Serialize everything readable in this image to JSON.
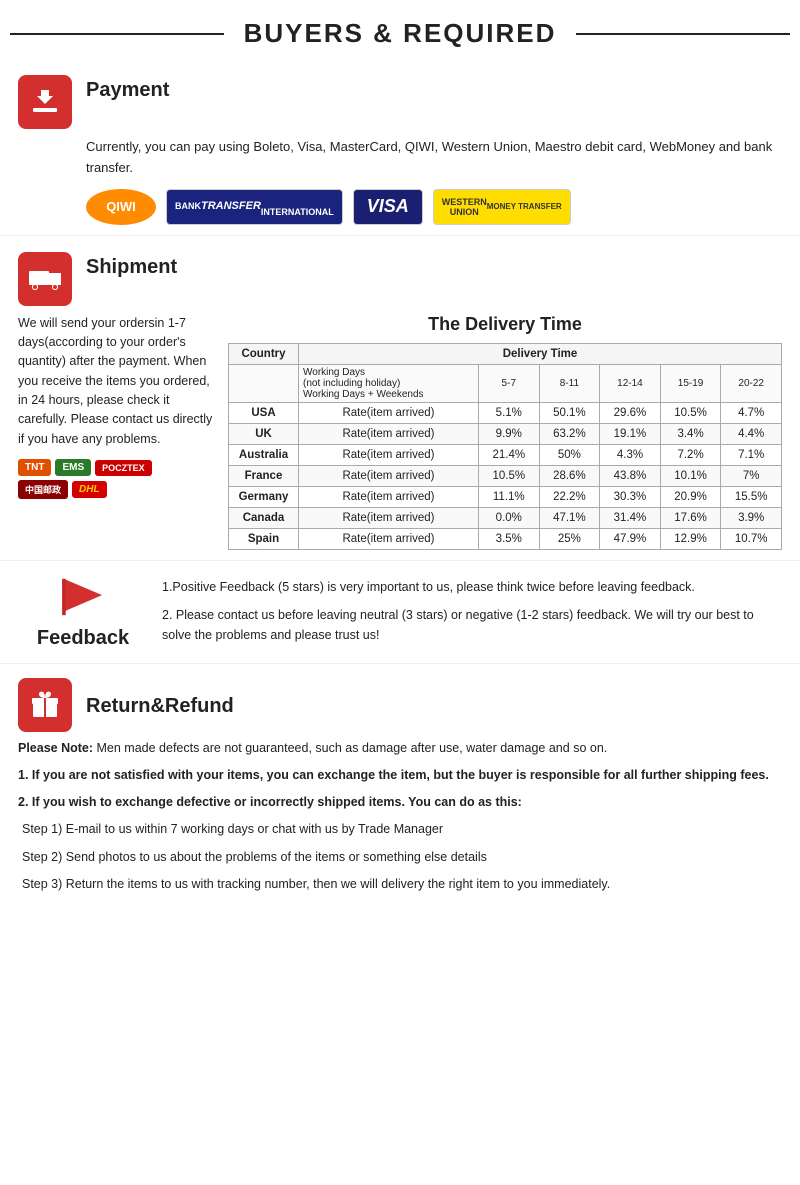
{
  "header": {
    "title": "BUYERS & REQUIRED"
  },
  "payment": {
    "section_label": "Payment",
    "description": "Currently, you can pay using Boleto, Visa, MasterCard, QIWI, Western Union, Maestro  debit card, WebMoney and bank transfer.",
    "logos": [
      {
        "name": "QIWI",
        "type": "qiwi"
      },
      {
        "name": "BANK TRANSFER\nINTERNATIONAL",
        "type": "bank"
      },
      {
        "name": "VISA",
        "type": "visa"
      },
      {
        "name": "WESTERN\nUNION\nMONEY TRANSFER",
        "type": "wu"
      }
    ]
  },
  "shipment": {
    "section_label": "Shipment",
    "description": "We will send your ordersin 1-7 days(according to your order's quantity) after the payment. When you receive the items you ordered, in 24  hours, please check it carefully. Please  contact us directly if you have any problems.",
    "delivery_title": "The Delivery Time",
    "table": {
      "headers": [
        "Country",
        "Delivery Time"
      ],
      "subheaders": [
        "Working Days\n(not including holiday)\nWorking Days + Weekends",
        "5-7",
        "8-11",
        "12-14",
        "15-19",
        "20-22"
      ],
      "rows": [
        {
          "country": "USA",
          "rate_label": "Rate(item arrived)",
          "v1": "5.1%",
          "v2": "50.1%",
          "v3": "29.6%",
          "v4": "10.5%",
          "v5": "4.7%"
        },
        {
          "country": "UK",
          "rate_label": "Rate(item arrived)",
          "v1": "9.9%",
          "v2": "63.2%",
          "v3": "19.1%",
          "v4": "3.4%",
          "v5": "4.4%"
        },
        {
          "country": "Australia",
          "rate_label": "Rate(item arrived)",
          "v1": "21.4%",
          "v2": "50%",
          "v3": "4.3%",
          "v4": "7.2%",
          "v5": "7.1%"
        },
        {
          "country": "France",
          "rate_label": "Rate(item arrived)",
          "v1": "10.5%",
          "v2": "28.6%",
          "v3": "43.8%",
          "v4": "10.1%",
          "v5": "7%"
        },
        {
          "country": "Germany",
          "rate_label": "Rate(item arrived)",
          "v1": "11.1%",
          "v2": "22.2%",
          "v3": "30.3%",
          "v4": "20.9%",
          "v5": "15.5%"
        },
        {
          "country": "Canada",
          "rate_label": "Rate(item arrived)",
          "v1": "0.0%",
          "v2": "47.1%",
          "v3": "31.4%",
          "v4": "17.6%",
          "v5": "3.9%"
        },
        {
          "country": "Spain",
          "rate_label": "Rate(item arrived)",
          "v1": "3.5%",
          "v2": "25%",
          "v3": "47.9%",
          "v4": "12.9%",
          "v5": "10.7%"
        }
      ]
    },
    "carriers": [
      "TNT",
      "EMS",
      "POCZTEX",
      "CHINA POST",
      "DHL"
    ]
  },
  "feedback": {
    "section_label": "Feedback",
    "point1": "1.Positive Feedback (5 stars) is very important to us, please think twice before leaving feedback.",
    "point2": "2. Please contact us before leaving neutral (3 stars) or negative  (1-2 stars) feedback. We will try our best to solve the problems and please trust us!"
  },
  "return_refund": {
    "section_label": "Return&Refund",
    "note_label": "Please Note:",
    "note_text": " Men made defects are not guaranteed, such as damage after use, water damage and so on.",
    "point1": "1. If you are not satisfied with your items, you can exchange the item, but the buyer is responsible for all further shipping fees.",
    "point2_label": "2. If you wish to exchange defective or incorrectly shipped items. You can do as this:",
    "steps": [
      "Step 1) E-mail to us within 7 working days or chat with us by Trade Manager",
      "Step 2) Send photos to us about the problems of the items or something else details",
      "Step 3) Return the items to us with tracking number, then we will delivery the right item to you immediately."
    ]
  }
}
